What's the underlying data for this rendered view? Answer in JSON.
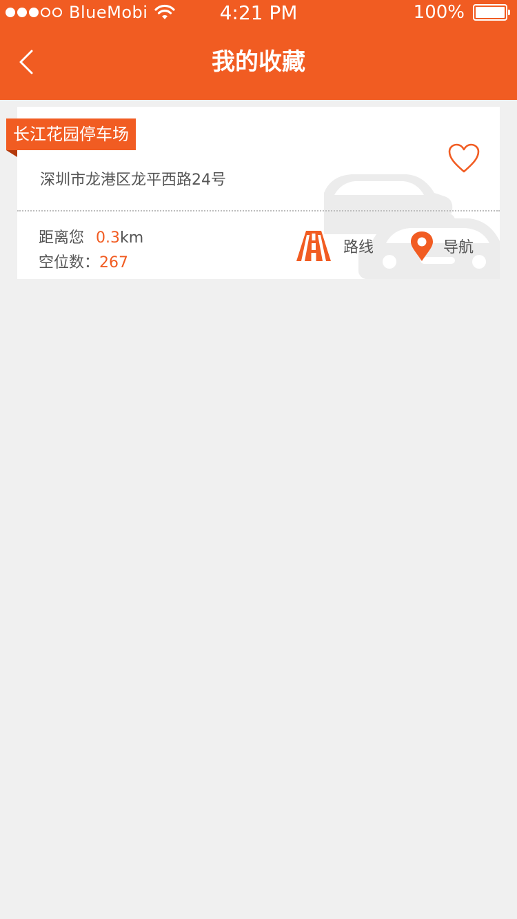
{
  "status_bar": {
    "carrier": "BlueMobi",
    "time": "4:21 PM",
    "battery": "100%"
  },
  "header": {
    "title": "我的收藏",
    "back_icon": "chevron-left-icon"
  },
  "favorites": [
    {
      "name": "长江花园停车场",
      "address": "深圳市龙港区龙平西路24号",
      "distance_label": "距离您",
      "distance_value": "0.3",
      "distance_unit": "km",
      "spaces_label": "空位数：",
      "spaces_value": "267",
      "route_label": "路线",
      "nav_label": "导航"
    }
  ],
  "colors": {
    "brand": "#f15c22",
    "background": "#f0f0f0",
    "card": "#ffffff",
    "text": "#555555"
  }
}
